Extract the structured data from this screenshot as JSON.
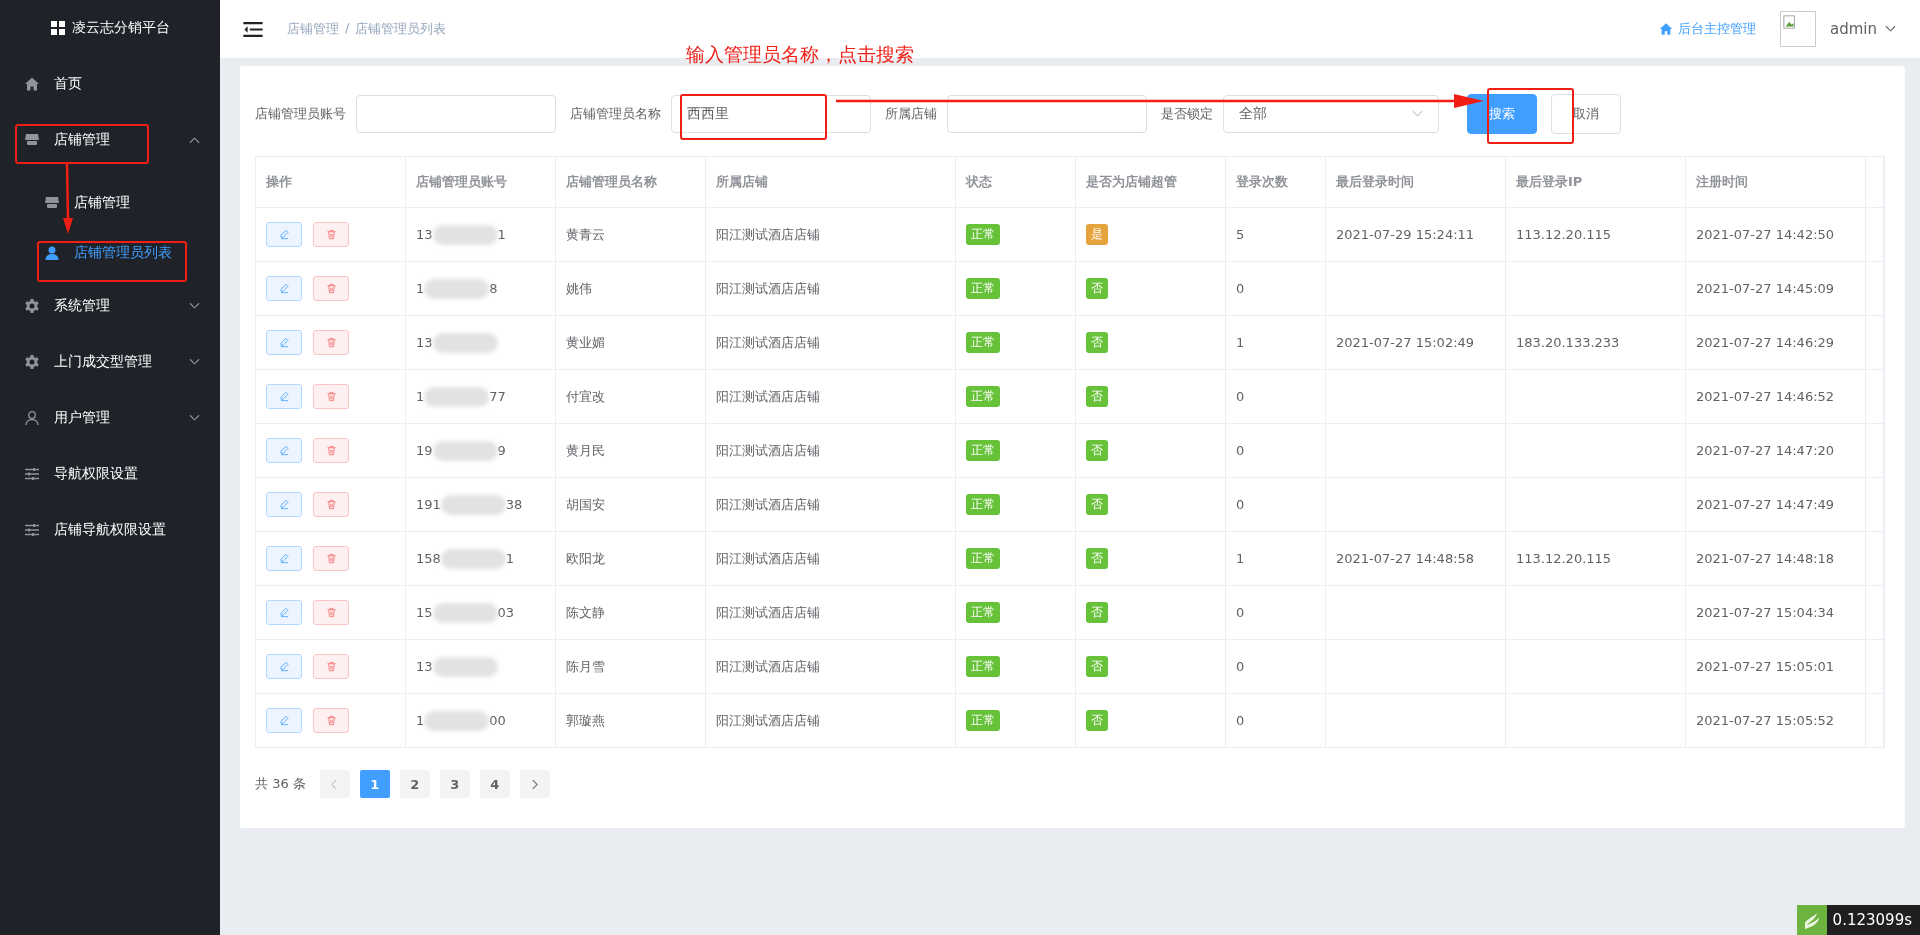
{
  "sidebar": {
    "logo": "凌云志分销平台",
    "items": [
      {
        "label": "首页",
        "kind": "home",
        "selected": false
      },
      {
        "label": "店铺管理",
        "kind": "store",
        "selected": false,
        "expanded": true,
        "children": [
          {
            "label": "店铺管理",
            "kind": "store",
            "selected": false
          },
          {
            "label": "店铺管理员列表",
            "kind": "person",
            "selected": true
          }
        ]
      },
      {
        "label": "系统管理",
        "kind": "gear",
        "selected": false,
        "expanded": false
      },
      {
        "label": "上门成交型管理",
        "kind": "gear",
        "selected": false,
        "expanded": false
      },
      {
        "label": "用户管理",
        "kind": "user",
        "selected": false,
        "expanded": false
      },
      {
        "label": "导航权限设置",
        "kind": "sliders",
        "selected": false
      },
      {
        "label": "店铺导航权限设置",
        "kind": "sliders",
        "selected": false
      }
    ]
  },
  "header": {
    "breadcrumb": [
      "店铺管理",
      "店铺管理员列表"
    ],
    "breadcrumb_separator": "/",
    "home_link": "后台主控管理",
    "user": "admin"
  },
  "filters": [
    {
      "label": "店铺管理员账号",
      "kind": "input"
    },
    {
      "label": "店铺管理员名称",
      "kind": "input",
      "value": "西西里"
    },
    {
      "label": "所属店铺",
      "kind": "input"
    },
    {
      "label": "是否锁定",
      "kind": "select",
      "value": "全部"
    }
  ],
  "buttons": [
    {
      "label": "搜索",
      "kind": "primary"
    },
    {
      "label": "取消",
      "kind": "plain"
    }
  ],
  "table": {
    "columns": [
      "操作",
      "店铺管理员账号",
      "店铺管理员名称",
      "所属店铺",
      "状态",
      "是否为店铺超管",
      "登录次数",
      "最后登录时间",
      "最后登录IP",
      "注册时间"
    ],
    "rows": [
      {
        "account_start": "13",
        "account_end": "1",
        "name": "黄青云",
        "shop": "阳江测试酒店店铺",
        "status": "正常",
        "super_admin": "是",
        "color": "#e6a23c",
        "logins": "5",
        "last_login": "2021-07-29 15:24:11",
        "last_ip": "113.12.20.115",
        "registered": "2021-07-27 14:42:50"
      },
      {
        "account_start": "1",
        "account_end": "8",
        "name": "姚伟",
        "shop": "阳江测试酒店店铺",
        "status": "正常",
        "super_admin": "否",
        "color": "#67c23a",
        "logins": "0",
        "registered": "2021-07-27 14:45:09"
      },
      {
        "account_start": "13",
        "name": "黄业媚",
        "shop": "阳江测试酒店店铺",
        "status": "正常",
        "super_admin": "否",
        "color": "#67c23a",
        "logins": "1",
        "last_login": "2021-07-27 15:02:49",
        "last_ip": "183.20.133.233",
        "registered": "2021-07-27 14:46:29"
      },
      {
        "account_start": "1",
        "account_end": "77",
        "name": "付宜改",
        "shop": "阳江测试酒店店铺",
        "status": "正常",
        "super_admin": "否",
        "color": "#67c23a",
        "logins": "0",
        "registered": "2021-07-27 14:46:52"
      },
      {
        "account_start": "19",
        "account_end": "9",
        "name": "黄月民",
        "shop": "阳江测试酒店店铺",
        "status": "正常",
        "super_admin": "否",
        "color": "#67c23a",
        "logins": "0",
        "registered": "2021-07-27 14:47:20"
      },
      {
        "account_start": "191",
        "account_end": "38",
        "name": "胡国安",
        "shop": "阳江测试酒店店铺",
        "status": "正常",
        "super_admin": "否",
        "color": "#67c23a",
        "logins": "0",
        "registered": "2021-07-27 14:47:49"
      },
      {
        "account_start": "158",
        "account_end": "1",
        "name": "欧阳龙",
        "shop": "阳江测试酒店店铺",
        "status": "正常",
        "super_admin": "否",
        "color": "#67c23a",
        "logins": "1",
        "last_login": "2021-07-27 14:48:58",
        "last_ip": "113.12.20.115",
        "registered": "2021-07-27 14:48:18"
      },
      {
        "account_start": "15",
        "account_end": "03",
        "name": "陈文静",
        "shop": "阳江测试酒店店铺",
        "status": "正常",
        "super_admin": "否",
        "color": "#67c23a",
        "logins": "0",
        "registered": "2021-07-27 15:04:34"
      },
      {
        "account_start": "13",
        "name": "陈月雪",
        "shop": "阳江测试酒店店铺",
        "status": "正常",
        "super_admin": "否",
        "color": "#67c23a",
        "logins": "0",
        "registered": "2021-07-27 15:05:01"
      },
      {
        "account_start": "1",
        "account_end": "00",
        "name": "郭璇燕",
        "shop": "阳江测试酒店店铺",
        "status": "正常",
        "super_admin": "否",
        "color": "#67c23a",
        "logins": "0",
        "registered": "2021-07-27 15:05:52"
      }
    ]
  },
  "pagination": {
    "total": "共 36 条",
    "pages": [
      {
        "label": "1",
        "selected": true
      },
      {
        "label": "2",
        "selected": false
      },
      {
        "label": "3",
        "selected": false
      },
      {
        "label": "4",
        "selected": false
      }
    ]
  },
  "annotation": "输入管理员名称，点击搜索",
  "timer_badge": "0.123099s"
}
